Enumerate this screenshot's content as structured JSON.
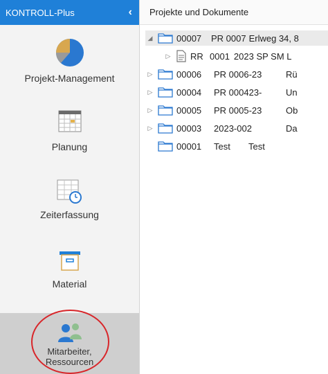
{
  "app": {
    "title": "KONTROLL-Plus",
    "collapse_icon": "chevron-left-icon"
  },
  "sidebar": {
    "items": [
      {
        "label": "Projekt-Management",
        "icon": "pie-chart-icon"
      },
      {
        "label": "Planung",
        "icon": "calendar-icon"
      },
      {
        "label": "Zeiterfassung",
        "icon": "timesheet-clock-icon"
      },
      {
        "label": "Material",
        "icon": "archive-box-icon"
      },
      {
        "label": "Mitarbeiter,\nRessourcen",
        "label_line1": "Mitarbeiter,",
        "label_line2": "Ressourcen",
        "icon": "people-icon",
        "active": true
      }
    ]
  },
  "main": {
    "header": "Projekte und Dokumente",
    "tree": [
      {
        "expanded": true,
        "caret": "◢",
        "icon": "folder-icon",
        "num": "00007",
        "code": "PR 0007",
        "desc": "Erlweg 34, 8",
        "selected": true
      },
      {
        "child": true,
        "caret": "▷",
        "icon": "document-icon",
        "num": "RR",
        "code": "0001",
        "desc": "2023  SP  SM  L"
      },
      {
        "caret": "▷",
        "icon": "folder-icon",
        "num": "00006",
        "code": "PR 0006-23",
        "desc": "Rü"
      },
      {
        "caret": "▷",
        "icon": "folder-icon",
        "num": "00004",
        "code": "PR 000423-",
        "desc": "Un"
      },
      {
        "caret": "▷",
        "icon": "folder-icon",
        "num": "00005",
        "code": "PR 0005-23",
        "desc": "Ob"
      },
      {
        "caret": "▷",
        "icon": "folder-icon",
        "num": "00003",
        "code": "2023-002",
        "desc": "Da"
      },
      {
        "caret": "",
        "icon": "folder-icon",
        "num": "00001",
        "code": "Test",
        "desc": "Test"
      }
    ]
  },
  "colors": {
    "accent": "#1f80d8",
    "active_bg": "#cfcfcf",
    "annotation": "#d8262a"
  }
}
